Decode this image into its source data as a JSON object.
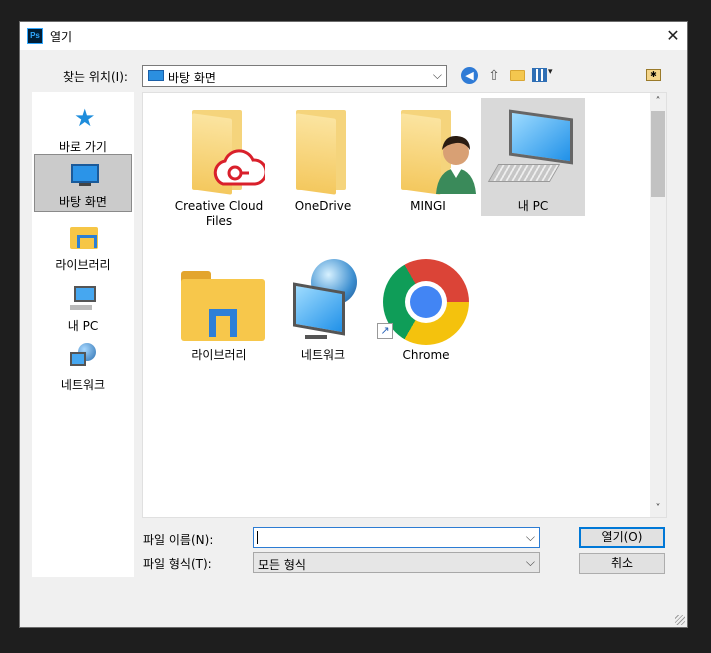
{
  "window": {
    "app_icon_text": "Ps",
    "title": "열기",
    "close_glyph": "✕"
  },
  "lookin": {
    "label": "찾는 위치(I):",
    "value": "바탕 화면"
  },
  "toolbar": {
    "back_glyph": "◀",
    "up_glyph": "⇧",
    "view_menu_glyph": "▾",
    "favorites_glyph": "✱"
  },
  "places": [
    {
      "label": "바로 가기",
      "icon": "quick-access-star-icon"
    },
    {
      "label": "바탕 화면",
      "icon": "desktop-icon",
      "selected": true
    },
    {
      "label": "라이브러리",
      "icon": "library-icon"
    },
    {
      "label": "내 PC",
      "icon": "this-pc-icon"
    },
    {
      "label": "네트워크",
      "icon": "network-icon"
    }
  ],
  "items": [
    {
      "name": "Creative Cloud Files",
      "icon": "creative-cloud-folder-icon"
    },
    {
      "name": "OneDrive",
      "icon": "folder-icon"
    },
    {
      "name": "MINGI",
      "icon": "user-folder-icon"
    },
    {
      "name": "내 PC",
      "icon": "computer-icon",
      "selected": true
    },
    {
      "name": "라이브러리",
      "icon": "library-folder-icon"
    },
    {
      "name": "네트워크",
      "icon": "network-globe-icon"
    },
    {
      "name": "Chrome",
      "icon": "chrome-icon"
    }
  ],
  "scroll": {
    "up_glyph": "˄",
    "down_glyph": "˅"
  },
  "form": {
    "filename_label": "파일 이름(N):",
    "filename_value": "",
    "filetype_label": "파일 형식(T):",
    "filetype_value": "모든 형식",
    "open_label": "열기(O)",
    "cancel_label": "취소"
  },
  "colors": {
    "accent": "#0078d7",
    "selection": "#cbcbcb"
  }
}
